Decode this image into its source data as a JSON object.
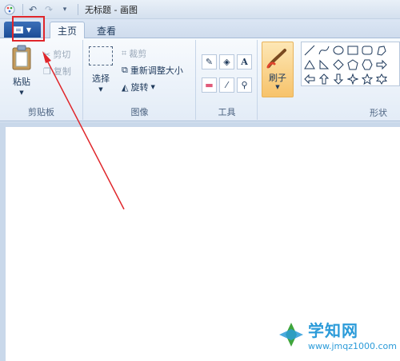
{
  "window": {
    "title": "无标题 - 画图"
  },
  "tabs": [
    {
      "label": "主页",
      "active": true
    },
    {
      "label": "查看",
      "active": false
    }
  ],
  "clipboard": {
    "paste_label": "粘贴",
    "cut_label": "剪切",
    "copy_label": "复制",
    "group_label": "剪贴板"
  },
  "image": {
    "select_label": "选择",
    "crop_label": "裁剪",
    "resize_label": "重新调整大小",
    "rotate_label": "旋转",
    "group_label": "图像"
  },
  "tools": {
    "group_label": "工具",
    "text_tool_glyph": "A"
  },
  "brushes": {
    "label": "刷子"
  },
  "shapes": {
    "group_label": "形状"
  },
  "watermark": {
    "title": "学知网",
    "url": "www.jmqz1000.com"
  },
  "colors": {
    "accent_blue": "#1c4d96",
    "highlight_red": "#e0262b",
    "brush_orange": "#f7c36b"
  }
}
